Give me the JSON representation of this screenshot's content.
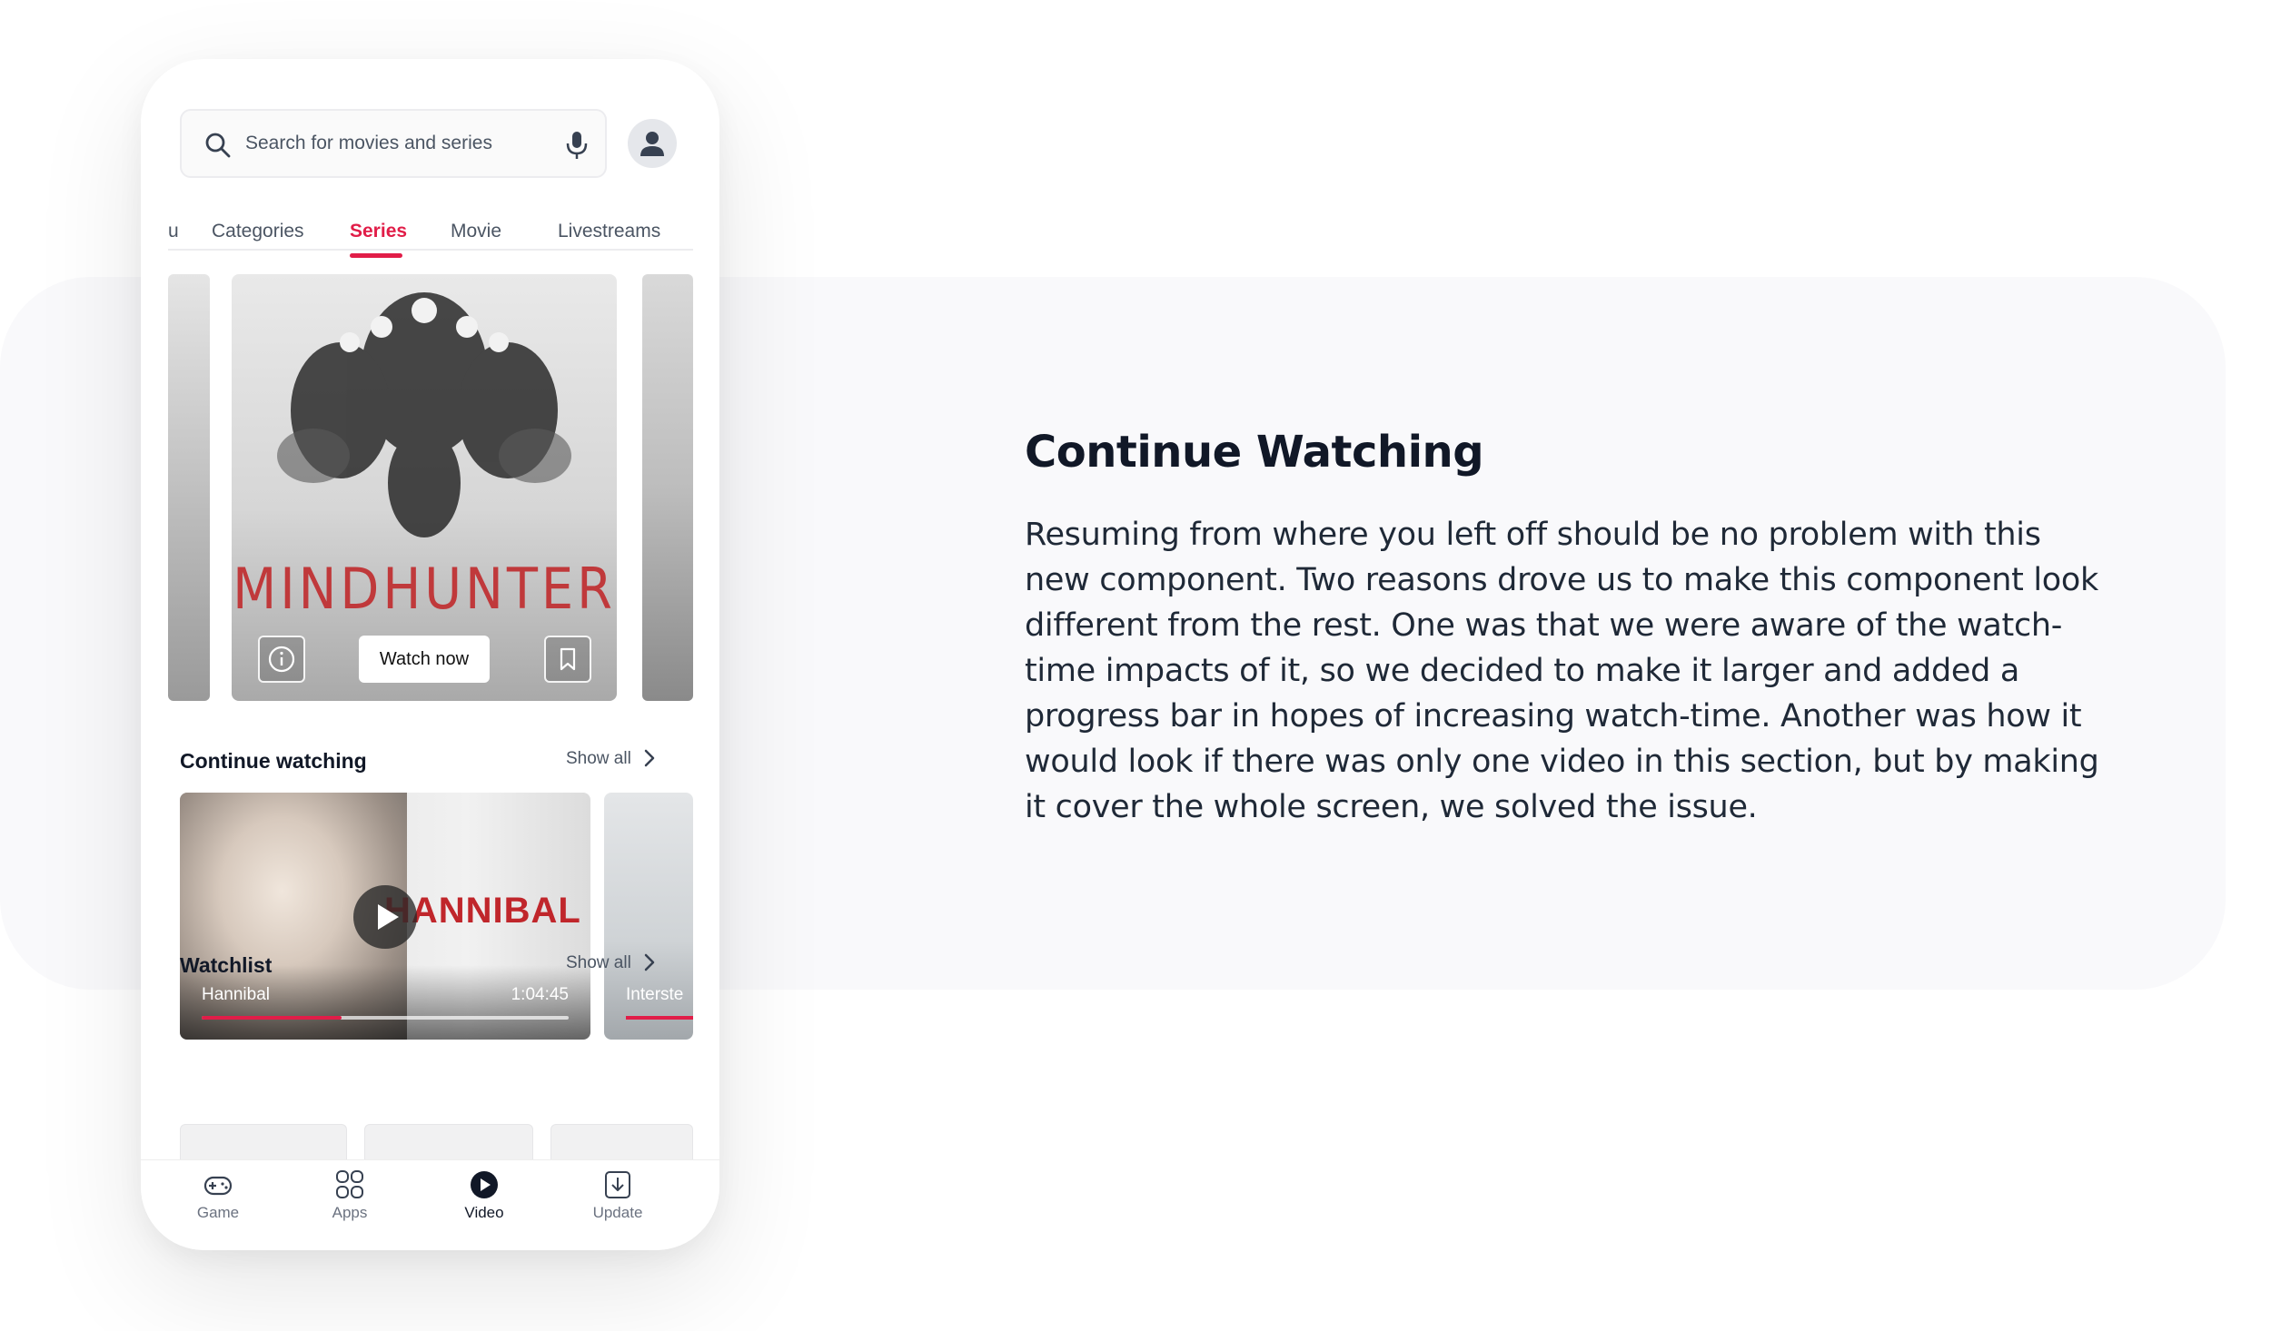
{
  "description": {
    "title": "Continue Watching",
    "body": "Resuming from where you left off should be no problem with this new component. Two reasons drove us to make this component look different from the rest. One was that we were aware of the watch-time impacts of it, so we decided to make it larger and added a progress bar in hopes of increasing watch-time. Another was how it would look if there was only one video in this section, but by making it cover the whole screen, we solved the issue."
  },
  "search": {
    "placeholder": "Search for movies and series",
    "icon": "search-icon",
    "mic_icon": "mic-icon"
  },
  "tabs": [
    {
      "label": "u",
      "active": false
    },
    {
      "label": "Categories",
      "active": false
    },
    {
      "label": "Series",
      "active": true
    },
    {
      "label": "Movie",
      "active": false
    },
    {
      "label": "Livestreams",
      "active": false
    }
  ],
  "hero": {
    "title": "MINDHUNTER",
    "watch_label": "Watch now"
  },
  "continue_watching": {
    "title": "Continue watching",
    "show_all": "Show all",
    "card": {
      "name": "Hannibal",
      "time": "1:04:45",
      "logo": "HANNIBAL",
      "progress": 0.38
    },
    "next_card": {
      "name": "Interste"
    }
  },
  "watchlist": {
    "title": "Watchlist",
    "show_all": "Show all"
  },
  "bottom_nav": [
    {
      "label": "Game",
      "icon": "gamepad-icon",
      "active": false
    },
    {
      "label": "Apps",
      "icon": "apps-grid-icon",
      "active": false
    },
    {
      "label": "Video",
      "icon": "play-circle-icon",
      "active": true
    },
    {
      "label": "Update",
      "icon": "download-icon",
      "active": false
    }
  ],
  "colors": {
    "accent": "#e11d48",
    "text_dark": "#111827",
    "panel_bg": "#f9f9fb"
  }
}
